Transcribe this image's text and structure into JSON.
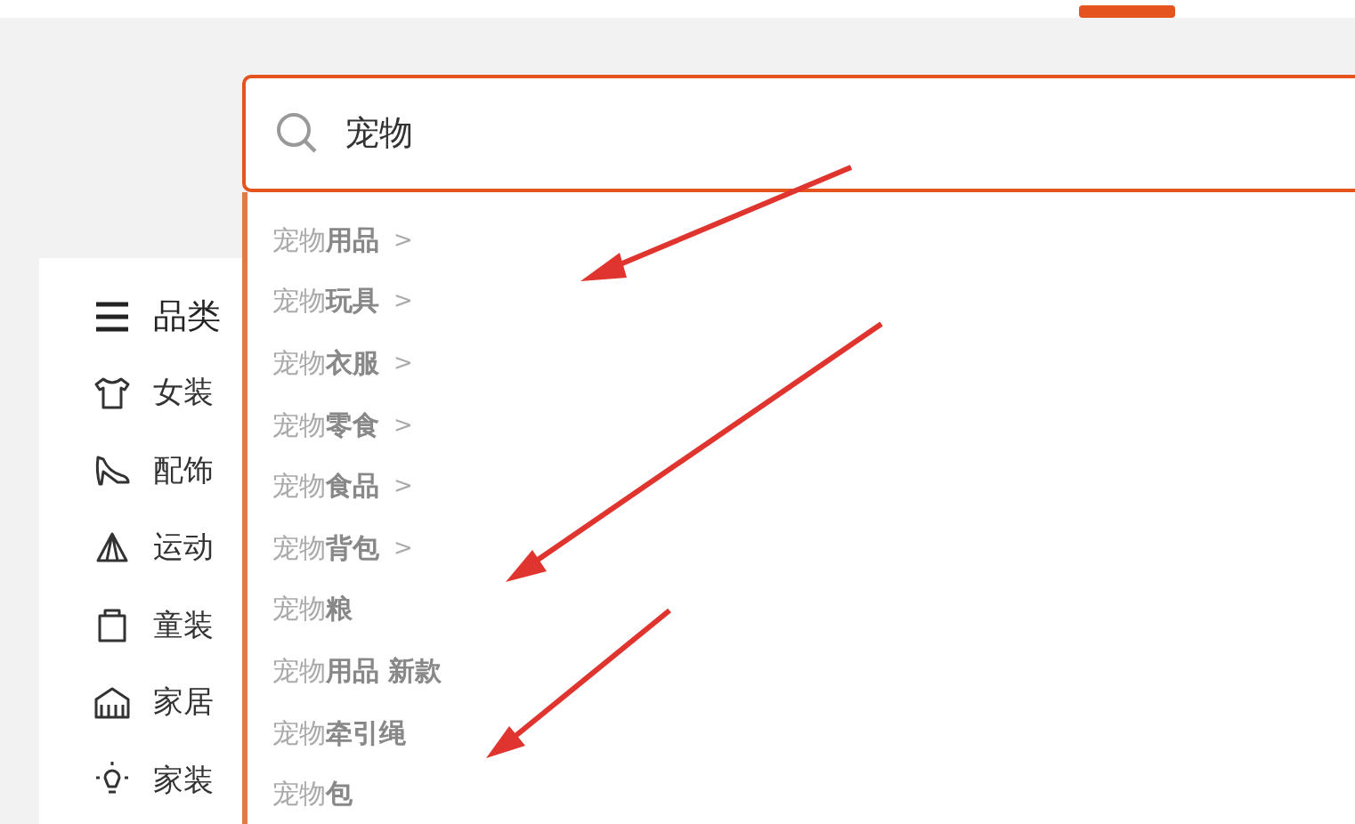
{
  "search": {
    "value": "宠物"
  },
  "sidebar": {
    "title": "品类",
    "items": [
      {
        "label": "女装"
      },
      {
        "label": "配饰"
      },
      {
        "label": "运动"
      },
      {
        "label": "童装"
      },
      {
        "label": "家居"
      },
      {
        "label": "家装"
      }
    ]
  },
  "suggestions": [
    {
      "text": "宠物**用品**",
      "chevron": ">"
    },
    {
      "text": "宠物**玩具**",
      "chevron": ">"
    },
    {
      "text": "宠物**衣服**",
      "chevron": ">"
    },
    {
      "text": "宠物**零食**",
      "chevron": ">"
    },
    {
      "text": "宠物**食品**",
      "chevron": ">"
    },
    {
      "text": "宠物**背包**",
      "chevron": ">"
    },
    {
      "text": "宠物**粮**"
    },
    {
      "text": "宠物**用品 新款**"
    },
    {
      "text": "宠物**牵引绳**"
    },
    {
      "text": "宠物**包**"
    }
  ]
}
